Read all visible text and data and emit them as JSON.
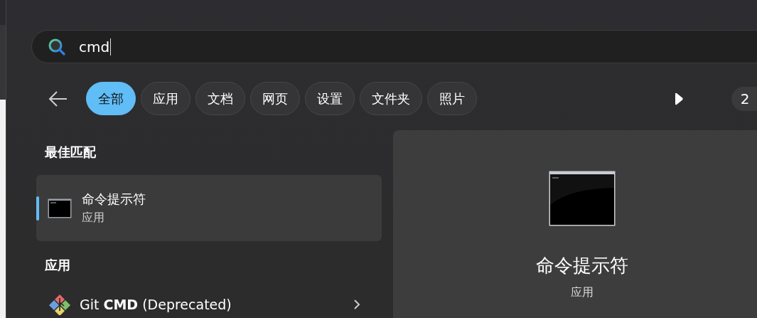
{
  "search": {
    "value": "cmd"
  },
  "filters": [
    {
      "label": "全部",
      "selected": true
    },
    {
      "label": "应用",
      "selected": false
    },
    {
      "label": "文档",
      "selected": false
    },
    {
      "label": "网页",
      "selected": false
    },
    {
      "label": "设置",
      "selected": false
    },
    {
      "label": "文件夹",
      "selected": false
    },
    {
      "label": "照片",
      "selected": false
    }
  ],
  "page_badge": "2",
  "best_match": {
    "heading": "最佳匹配",
    "item": {
      "name": "命令提示符",
      "type": "应用",
      "selected": true
    }
  },
  "apps": {
    "heading": "应用",
    "items": [
      {
        "name": "Git **CMD** (Deprecated)"
      }
    ]
  },
  "details": {
    "name": "命令提示符",
    "type": "应用"
  }
}
